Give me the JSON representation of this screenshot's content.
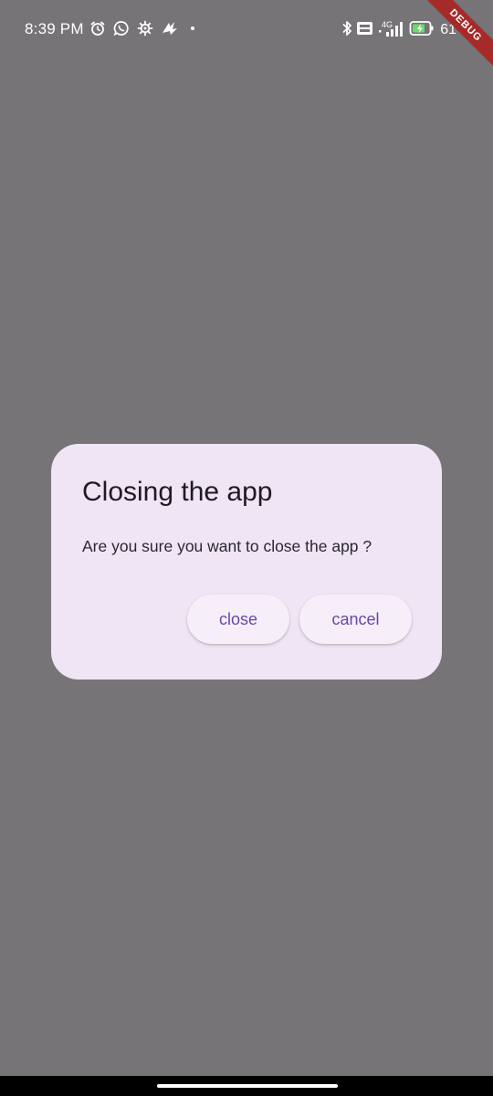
{
  "status_bar": {
    "time": "8:39 PM",
    "battery_text": "61",
    "network_label": "4G",
    "icons_left": [
      "alarm-icon",
      "whatsapp-icon",
      "gear-icon",
      "app-icon",
      "dot-icon"
    ],
    "icons_right": [
      "bluetooth-icon",
      "volte-icon",
      "signal-icon",
      "battery-icon"
    ]
  },
  "debug_banner": "DEBUG",
  "dialog": {
    "title": "Closing the app",
    "message": "Are you sure you want to close the app ?",
    "close_label": "close",
    "cancel_label": "cancel"
  },
  "colors": {
    "scrim": "#767476",
    "dialog_bg": "#efe5f5",
    "button_text": "#6a45a8",
    "debug_ribbon": "#a52a2a"
  }
}
